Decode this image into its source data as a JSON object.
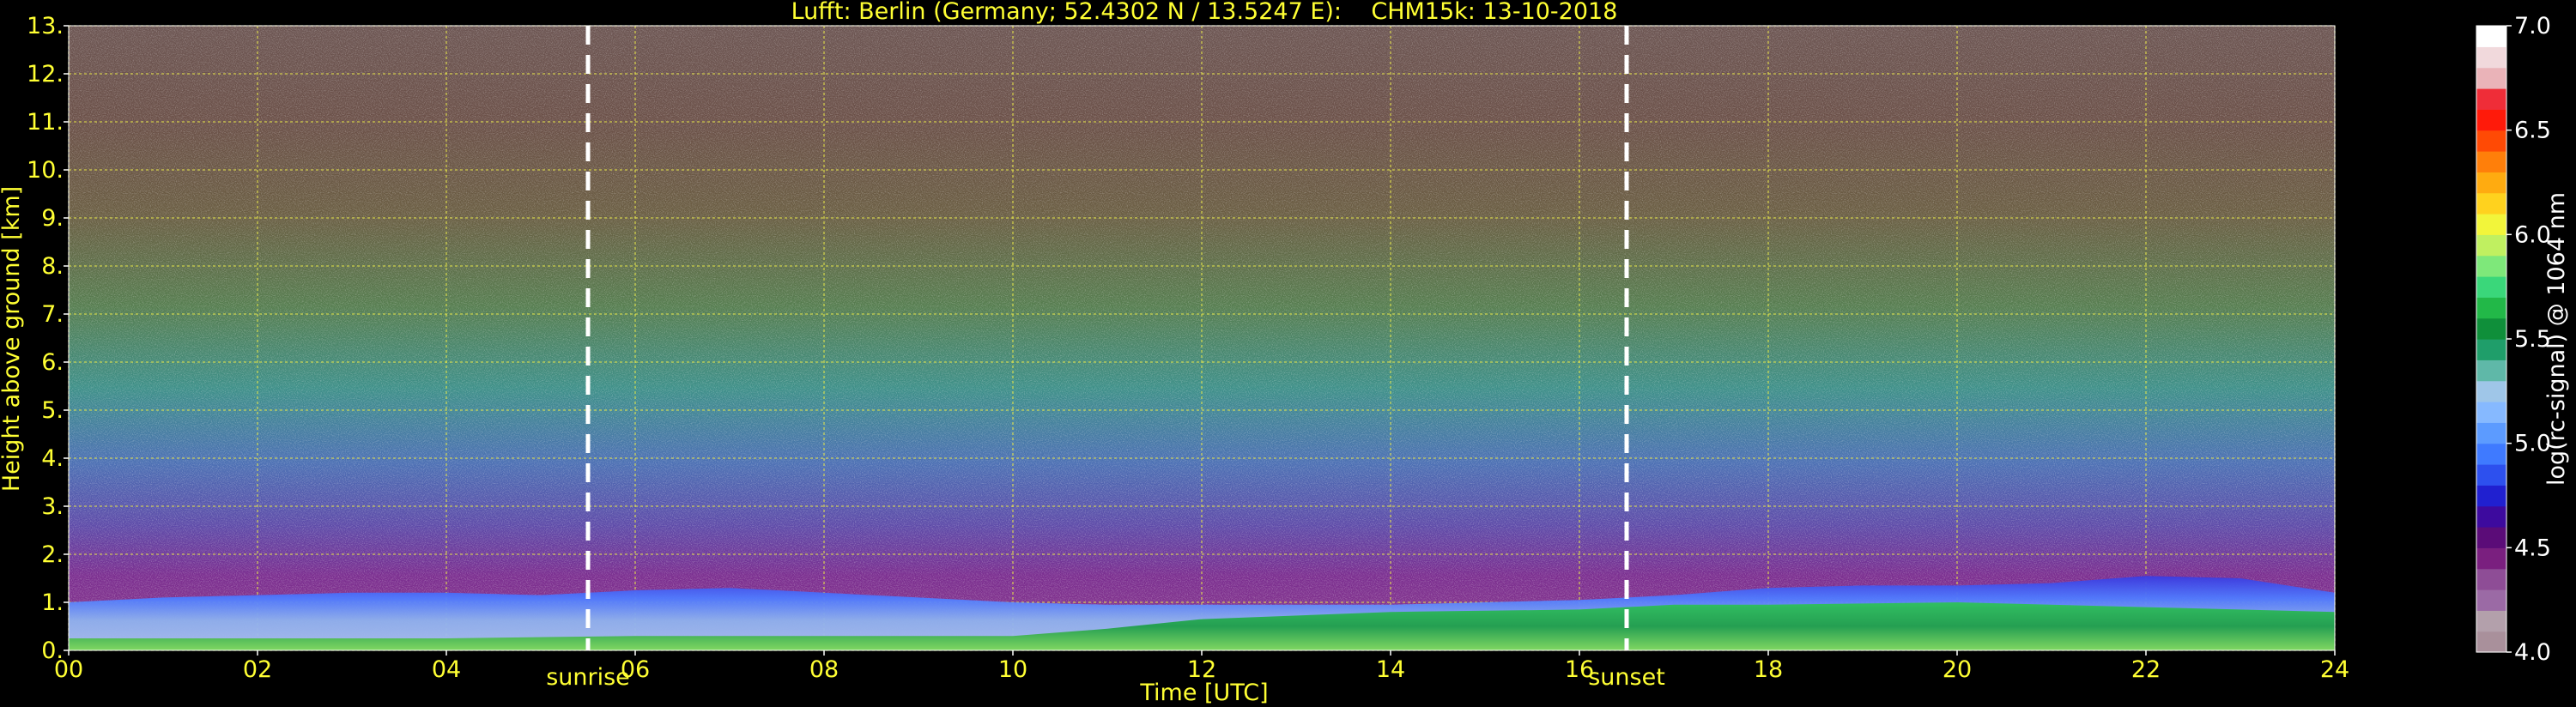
{
  "chart_data": {
    "type": "heatmap",
    "title": "Lufft: Berlin (Germany; 52.4302 N / 13.5247 E):    CHM15k: 13-10-2018",
    "xlabel": "Time [UTC]",
    "ylabel": "Height above ground [km]",
    "xlim": [
      0,
      24
    ],
    "ylim": [
      0,
      13
    ],
    "x_ticks": [
      "00",
      "02",
      "04",
      "06",
      "08",
      "10",
      "12",
      "14",
      "16",
      "18",
      "20",
      "22",
      "24"
    ],
    "x_tick_values": [
      0,
      2,
      4,
      6,
      8,
      10,
      12,
      14,
      16,
      18,
      20,
      22,
      24
    ],
    "y_ticks": [
      "0.",
      "1.",
      "2.",
      "3.",
      "4.",
      "5.",
      "6.",
      "7.",
      "8.",
      "9.",
      "10.",
      "11.",
      "12.",
      "13."
    ],
    "y_tick_values": [
      0,
      1,
      2,
      3,
      4,
      5,
      6,
      7,
      8,
      9,
      10,
      11,
      12,
      13
    ],
    "grid": true,
    "annotations": [
      {
        "label": "sunrise",
        "x": 5.5
      },
      {
        "label": "sunset",
        "x": 16.5
      }
    ],
    "colorbar": {
      "label": "log(rc-signal) @ 1064 nm",
      "range": [
        4.0,
        7.0
      ],
      "ticks": [
        "4.0",
        "4.5",
        "5.0",
        "5.5",
        "6.0",
        "6.5",
        "7.0"
      ],
      "tick_values": [
        4.0,
        4.5,
        5.0,
        5.5,
        6.0,
        6.5,
        7.0
      ],
      "colors": [
        "#a9909b",
        "#b3a0ab",
        "#9b6aa5",
        "#8e4d96",
        "#7a1f7f",
        "#5b0c78",
        "#3d0a9e",
        "#2020d0",
        "#2d50ee",
        "#3f7aff",
        "#5c9bff",
        "#86b9ff",
        "#9fc6e8",
        "#5fb8a8",
        "#1f9e6a",
        "#0f8f3a",
        "#22b848",
        "#3ad77a",
        "#7ee87a",
        "#c0f060",
        "#f2f53a",
        "#ffd21e",
        "#ffab10",
        "#ff7f0a",
        "#ff4a05",
        "#ff1a0a",
        "#ef2d38",
        "#eab3b8",
        "#f1d9dc",
        "#ffffff"
      ]
    },
    "boundary_layer_top_km": {
      "x": [
        0,
        1,
        2,
        3,
        4,
        5,
        6,
        7,
        8,
        9,
        10,
        11,
        12,
        13,
        14,
        15,
        16,
        17,
        18,
        19,
        20,
        21,
        22,
        23,
        24
      ],
      "y": [
        1.0,
        1.1,
        1.15,
        1.2,
        1.2,
        1.15,
        1.25,
        1.3,
        1.2,
        1.1,
        1.0,
        0.95,
        0.95,
        0.95,
        0.95,
        1.0,
        1.05,
        1.15,
        1.3,
        1.35,
        1.35,
        1.4,
        1.55,
        1.5,
        1.2
      ]
    },
    "surface_layer_top_km": {
      "x": [
        0,
        2,
        4,
        6,
        8,
        10,
        11,
        12,
        14,
        16,
        17,
        18,
        20,
        22,
        24
      ],
      "y": [
        0.25,
        0.25,
        0.25,
        0.3,
        0.3,
        0.3,
        0.45,
        0.65,
        0.8,
        0.85,
        0.95,
        0.95,
        1.0,
        0.9,
        0.8
      ]
    }
  }
}
